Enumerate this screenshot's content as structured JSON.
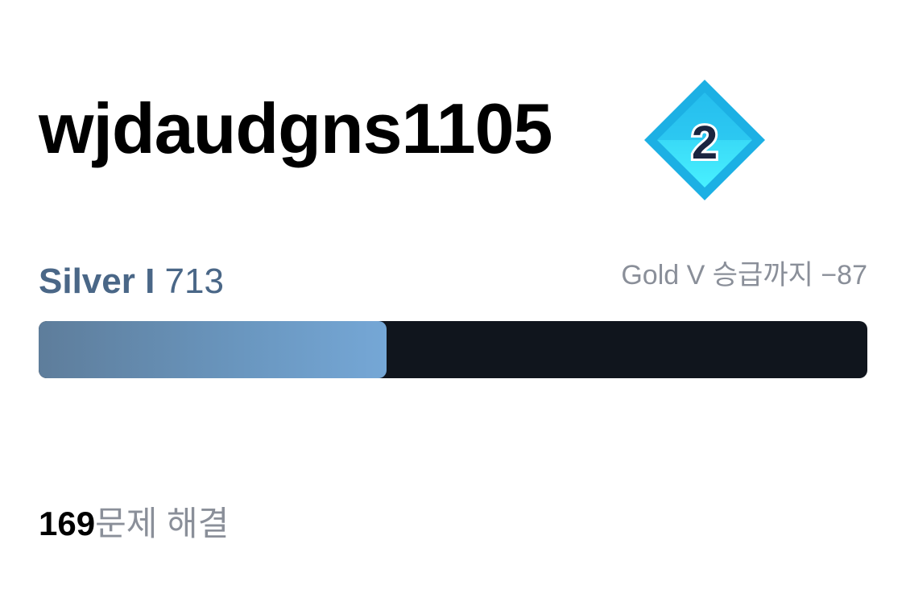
{
  "profile": {
    "username": "wjdaudgns1105"
  },
  "badge": {
    "level": "2",
    "icon": "diamond-tier-badge",
    "colors": {
      "outer": "#1fb3e6",
      "inner": "#3ee6ff",
      "text": "#1a2540"
    }
  },
  "rank": {
    "tier": "Silver I",
    "rating": "713",
    "promotion_text": "Gold V 승급까지 −87",
    "progress_fraction": 0.42,
    "colors": {
      "tier_text": "#4a6787",
      "bar_track": "#10151d",
      "bar_fill_start": "#5e7d9b",
      "bar_fill_end": "#75a7d6"
    }
  },
  "solved": {
    "count": "169",
    "label": "문제 해결"
  }
}
